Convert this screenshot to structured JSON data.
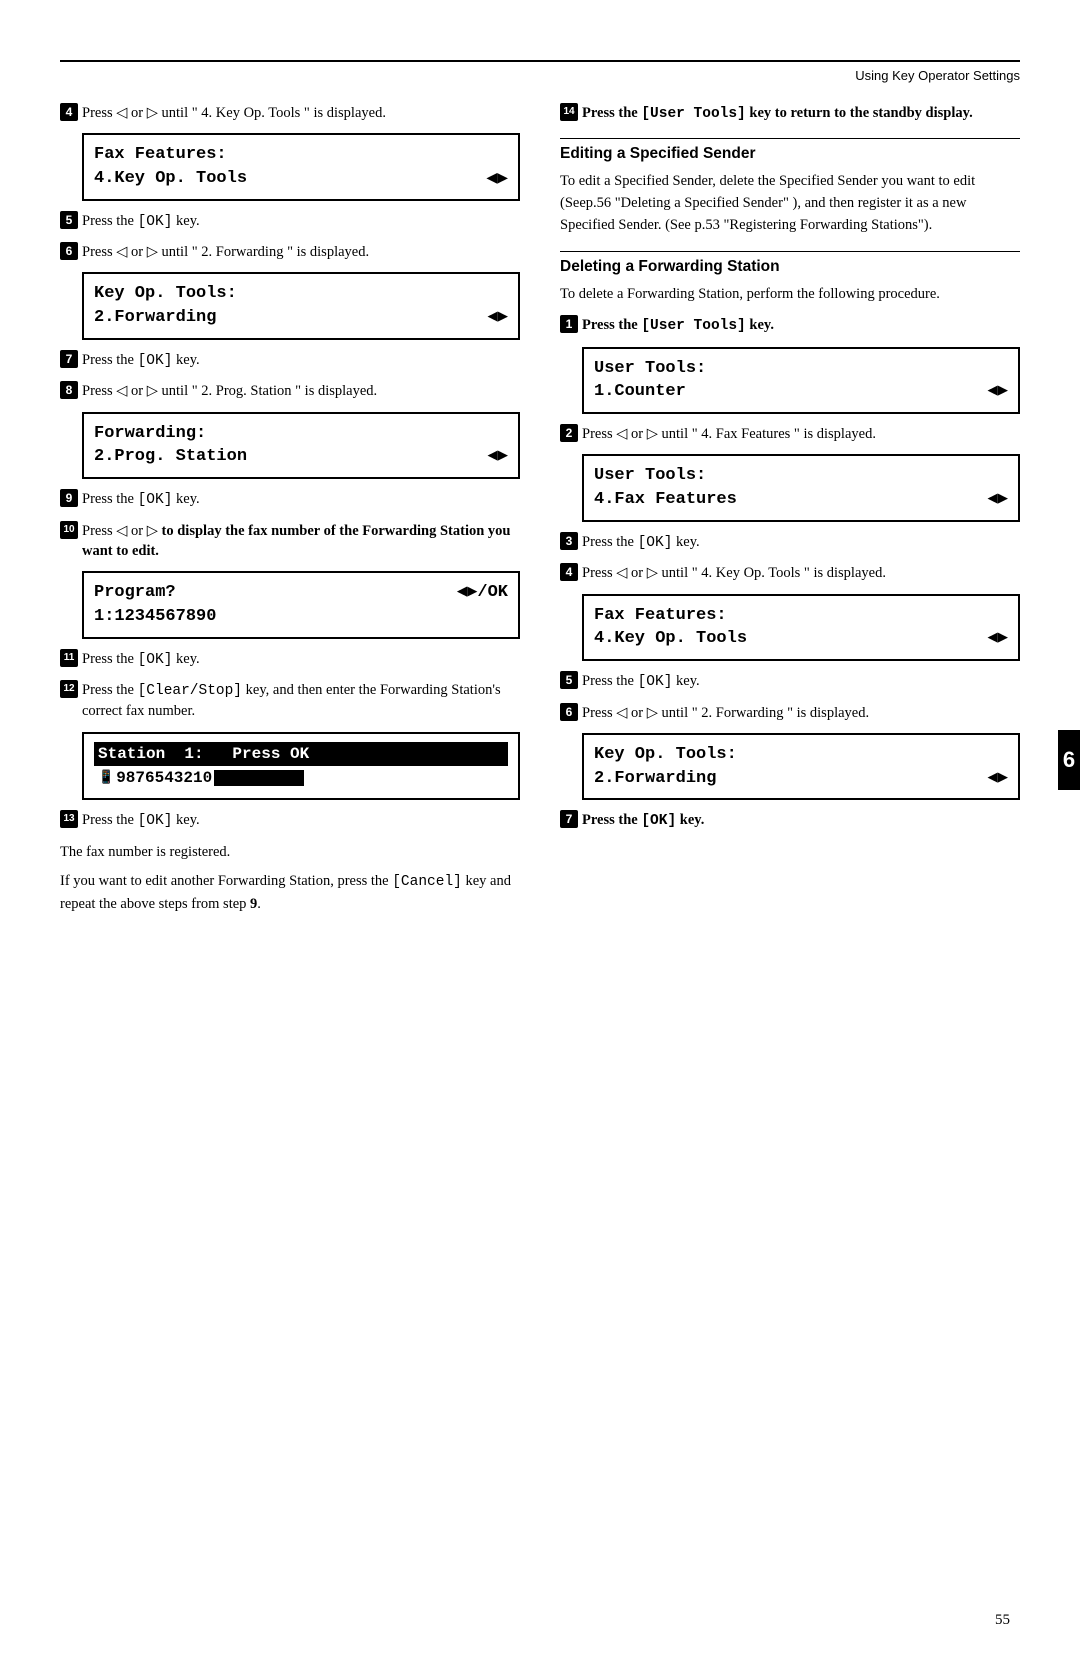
{
  "header": {
    "line": true,
    "text": "Using Key Operator Settings"
  },
  "left_column": {
    "steps": [
      {
        "id": "step4",
        "num": "4",
        "text": "Press ◁ or ▷ until \" 4. Key Op. Tools \" is displayed.",
        "lcd": [
          "Fax Features:",
          "4.Key Op. Tools  ◀▶"
        ]
      },
      {
        "id": "step5",
        "num": "5",
        "text": "Press the [OK] key."
      },
      {
        "id": "step6",
        "num": "6",
        "text": "Press ◁ or ▷ until \" 2. Forwarding \" is displayed.",
        "lcd": [
          "Key Op. Tools:",
          "2.Forwarding     ◀▶"
        ]
      },
      {
        "id": "step7",
        "num": "7",
        "text": "Press the [OK] key."
      },
      {
        "id": "step8",
        "num": "8",
        "text": "Press ◁ or ▷ until \" 2. Prog. Station \" is displayed.",
        "lcd": [
          "Forwarding:",
          "2.Prog. Station  ◀▶"
        ]
      },
      {
        "id": "step9",
        "num": "9",
        "text": "Press the [OK] key."
      },
      {
        "id": "step10",
        "num": "10",
        "text": "Press ◁ or ▷ to display the fax number of the Forwarding Station you want to edit.",
        "lcd_line1": "Program?        ◀▶/OK",
        "lcd_line2": "1:1234567890"
      },
      {
        "id": "step11",
        "num": "11",
        "text": "Press the [OK] key."
      },
      {
        "id": "step12",
        "num": "12",
        "text": "Press the [Clear/Stop] key, and then enter the Forwarding Station's correct fax number.",
        "lcd_station_line1": "Station  1:   Press OK",
        "lcd_station_line2": "9876543210"
      },
      {
        "id": "step13",
        "num": "13",
        "text": "Press the [OK] key."
      }
    ],
    "after_steps": {
      "para1": "The fax number is registered.",
      "para2": "If you want to edit another Forwarding Station, press the [Cancel] key and repeat the above steps from step 9."
    }
  },
  "right_column": {
    "step14": {
      "num": "14",
      "text": "Press the [User Tools] key to return to the standby display."
    },
    "section_editing": {
      "title": "Editing a Specified Sender",
      "para": "To edit a Specified Sender, delete the Specified Sender you want to edit (Seep.56 \"Deleting a Specified Sender\" ), and then register it as a new Specified Sender. (See p.53 \"Registering Forwarding Stations\")."
    },
    "section_deleting": {
      "title": "Deleting a Forwarding Station",
      "para": "To delete a Forwarding Station, perform the following procedure.",
      "steps": [
        {
          "id": "del_step1",
          "num": "1",
          "text": "Press the [User Tools] key.",
          "lcd": [
            "User Tools:",
            "1.Counter        ◀▶"
          ]
        },
        {
          "id": "del_step2",
          "num": "2",
          "text": "Press ◁ or ▷ until \" 4. Fax Features \" is displayed.",
          "lcd": [
            "User Tools:",
            "4.Fax Features   ◀▶"
          ]
        },
        {
          "id": "del_step3",
          "num": "3",
          "text": "Press the [OK] key."
        },
        {
          "id": "del_step4",
          "num": "4",
          "text": "Press ◁ or ▷ until \" 4. Key Op. Tools \" is displayed.",
          "lcd": [
            "Fax Features:",
            "4.Key Op. Tools  ◀▶"
          ]
        },
        {
          "id": "del_step5",
          "num": "5",
          "text": "Press the [OK] key."
        },
        {
          "id": "del_step6",
          "num": "6",
          "text": "Press ◁ or ▷ until \" 2. Forwarding \" is displayed.",
          "lcd": [
            "Key Op. Tools:",
            "2.Forwarding     ◀▶"
          ]
        },
        {
          "id": "del_step7",
          "num": "7",
          "text": "Press the [OK] key."
        }
      ]
    }
  },
  "page_number": "55",
  "tab_label": "6"
}
